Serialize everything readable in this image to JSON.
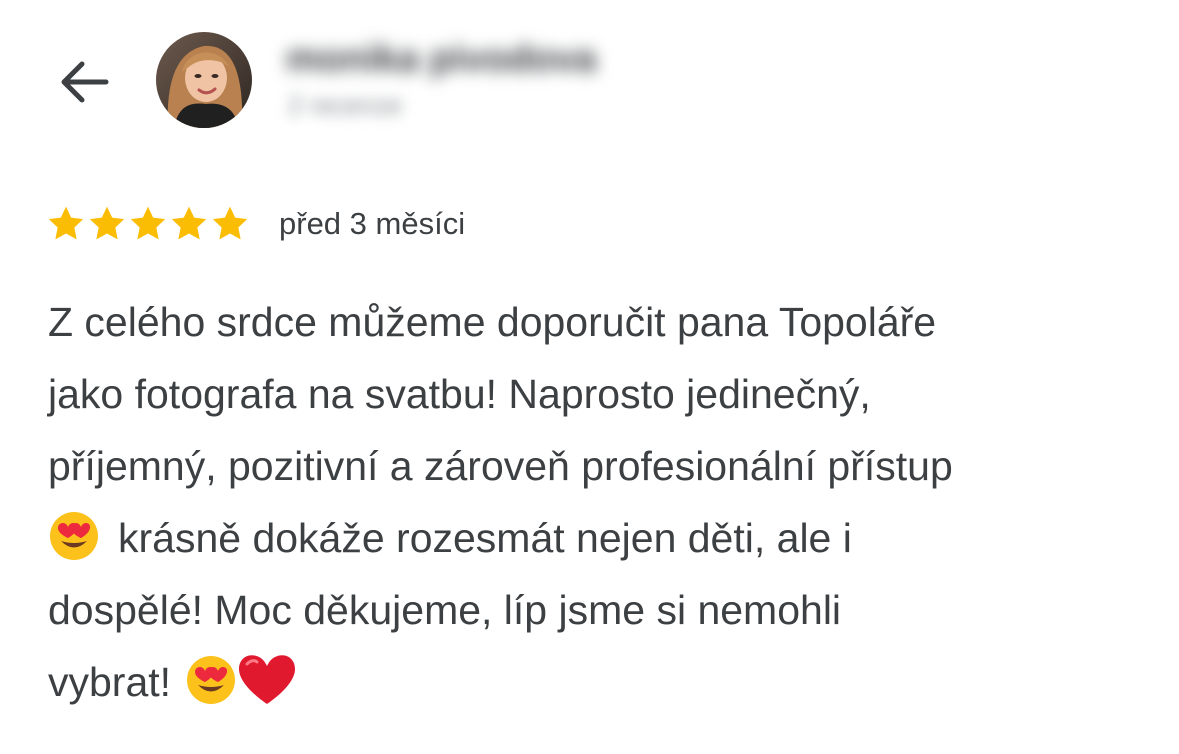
{
  "header": {
    "back_icon": "arrow-left-icon",
    "reviewer_name": "monika pivodova",
    "reviewer_meta": "2 recenze"
  },
  "review": {
    "rating": 5,
    "rating_max": 5,
    "star_color": "#fbbc04",
    "date": "před 3 měsíci",
    "lines": [
      "Z celého srdce můžeme doporučit pana Topoláře",
      "jako fotografa na svatbu! Naprosto jedinečný,",
      "příjemný, pozitivní a zároveň profesionální přístup",
      "krásně dokáže rozesmát nejen děti, ale i",
      "dospělé! Moc děkujeme, líp jsme si nemohli",
      "vybrat!"
    ],
    "emoji": {
      "heart_eyes": "smiling-face-with-heart-eyes-emoji",
      "heart": "red-heart-emoji"
    }
  },
  "colors": {
    "text": "#3c4043",
    "muted": "#80868b",
    "background": "#ffffff"
  }
}
